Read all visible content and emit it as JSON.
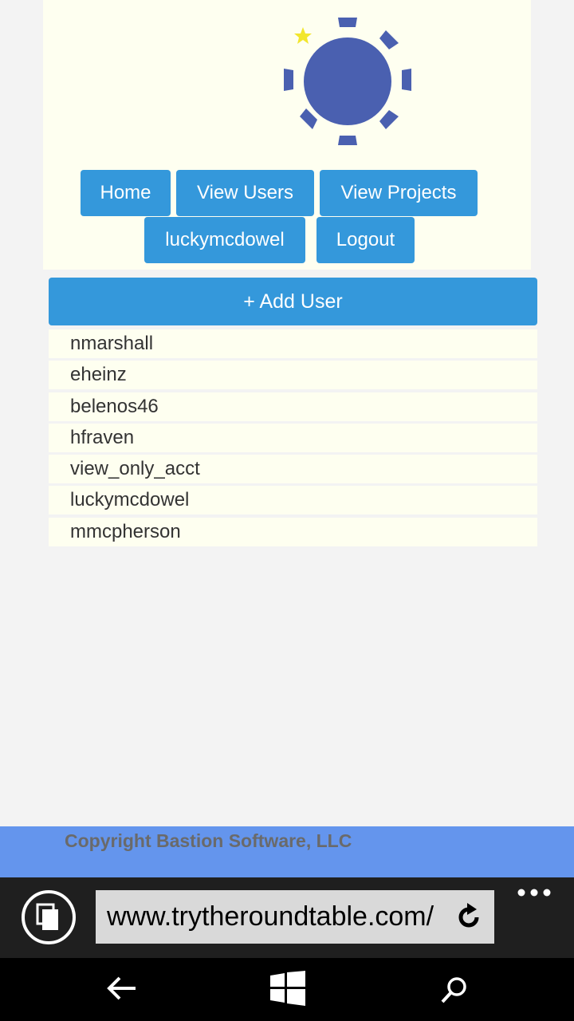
{
  "nav": {
    "home": "Home",
    "view_users": "View Users",
    "view_projects": "View Projects",
    "account": "luckymcdowel",
    "logout": "Logout"
  },
  "add_user_label": "+ Add User",
  "users": [
    "nmarshall",
    "eheinz",
    "belenos46",
    "hfraven",
    "view_only_acct",
    "luckymcdowel",
    "mmcpherson"
  ],
  "footer": {
    "copyright": "Copyright Bastion Software, LLC"
  },
  "browser": {
    "url": "www.trytheroundtable.com/"
  },
  "colors": {
    "button": "#3498db",
    "panel": "#fefff0",
    "footer": "#6495ed",
    "logo": "#4a60b0",
    "star": "#f2e62d"
  },
  "icons": [
    "round-table-logo",
    "star-icon",
    "tabs-icon",
    "reload-icon",
    "more-icon",
    "back-arrow-icon",
    "windows-icon",
    "search-icon"
  ]
}
